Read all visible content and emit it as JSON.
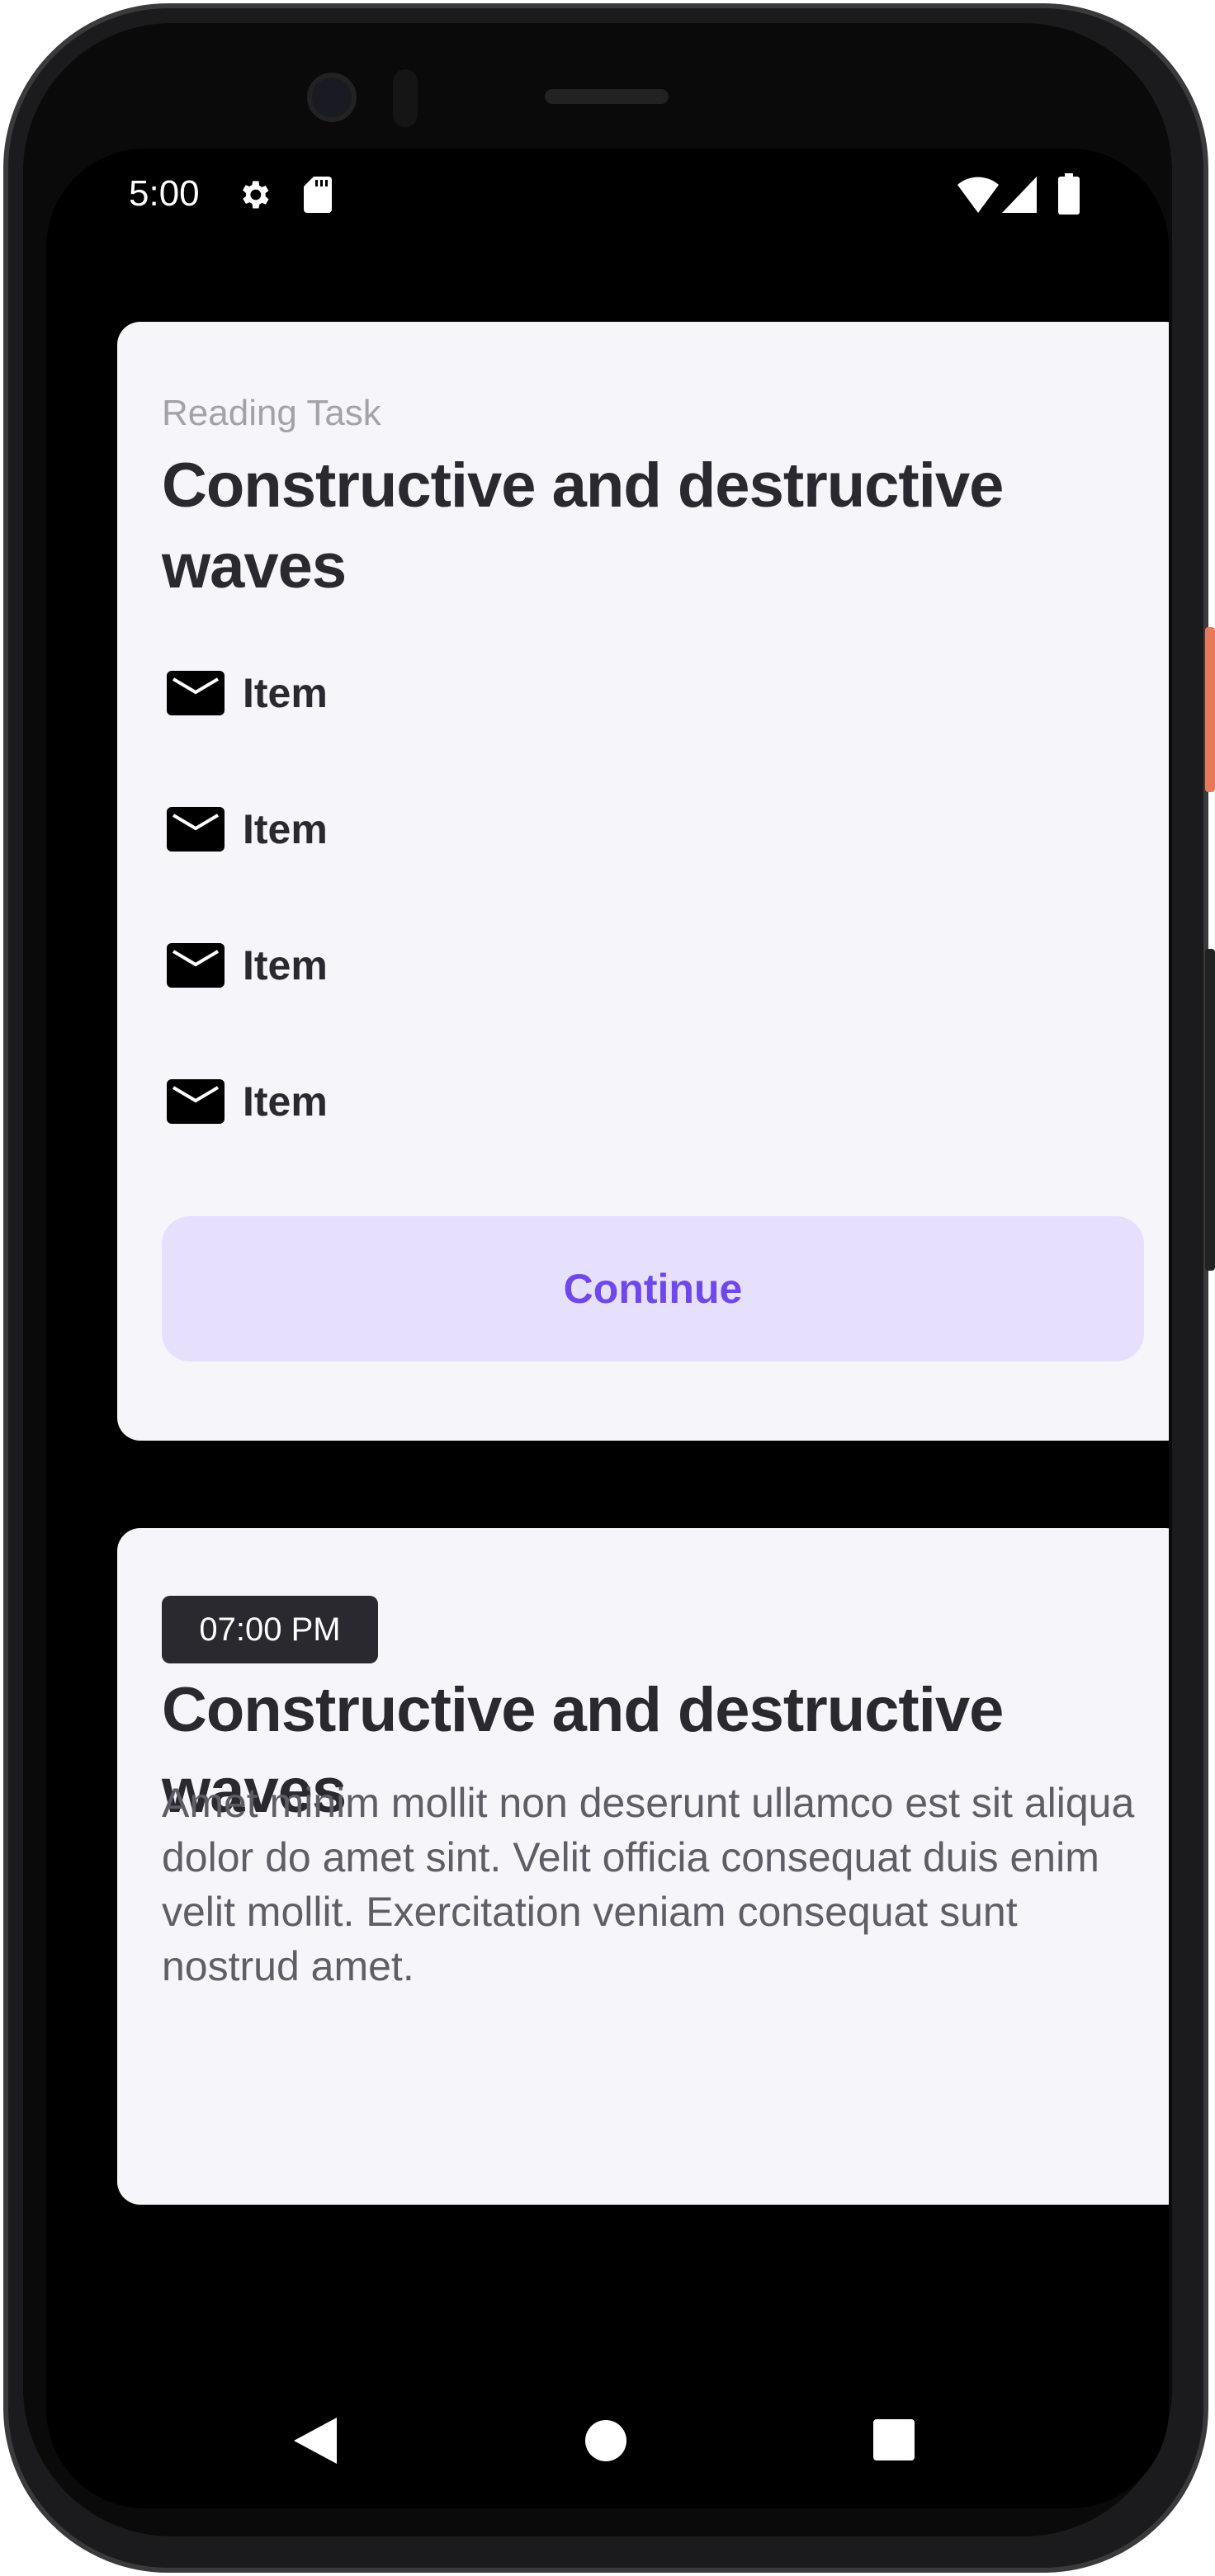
{
  "status_bar": {
    "time": "5:00",
    "icons": [
      "gear-icon",
      "sd-card-icon",
      "wifi-icon",
      "signal-icon",
      "battery-icon"
    ]
  },
  "card1": {
    "label": "Reading Task",
    "title": "Constructive and destructive waves",
    "items": [
      {
        "icon": "mail-icon",
        "label": "Item"
      },
      {
        "icon": "mail-icon",
        "label": "Item"
      },
      {
        "icon": "mail-icon",
        "label": "Item"
      },
      {
        "icon": "mail-icon",
        "label": "Item"
      }
    ],
    "button": "Continue"
  },
  "card2": {
    "time_badge": "07:00 PM",
    "title": "Constructive and destructive waves",
    "body": "Amet minim mollit non deserunt ullamco est sit aliqua dolor do amet sint. Velit officia consequat duis enim velit mollit. Exercitation veniam consequat sunt nostrud amet."
  },
  "nav_bar": {
    "icons": [
      "back-icon",
      "home-icon",
      "recents-icon"
    ]
  },
  "colors": {
    "accent": "#7047eb",
    "button_bg": "#e6e0fd",
    "card_bg": "#f6f5fa",
    "text_dark": "#2a2930"
  }
}
